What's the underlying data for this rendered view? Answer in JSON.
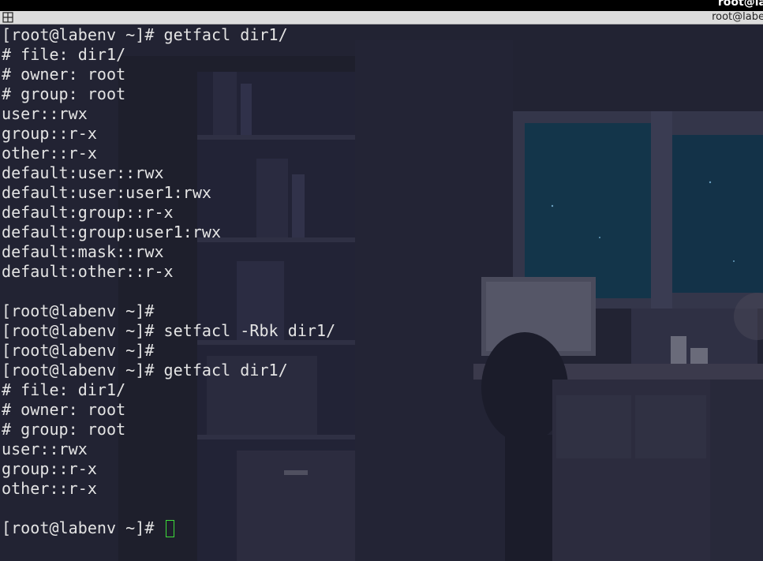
{
  "window": {
    "top_title": "root@la",
    "tab_title": "root@labe"
  },
  "terminal": {
    "lines": [
      "[root@labenv ~]# getfacl dir1/",
      "# file: dir1/",
      "# owner: root",
      "# group: root",
      "user::rwx",
      "group::r-x",
      "other::r-x",
      "default:user::rwx",
      "default:user:user1:rwx",
      "default:group::r-x",
      "default:group:user1:rwx",
      "default:mask::rwx",
      "default:other::r-x",
      "",
      "[root@labenv ~]#",
      "[root@labenv ~]# setfacl -Rbk dir1/",
      "[root@labenv ~]#",
      "[root@labenv ~]# getfacl dir1/",
      "# file: dir1/",
      "# owner: root",
      "# group: root",
      "user::rwx",
      "group::r-x",
      "other::r-x",
      "",
      "[root@labenv ~]# "
    ]
  },
  "icons": {
    "tab": "terminal-grid-icon"
  },
  "colors": {
    "text": "#e4e4e4",
    "cursor": "#3ddc3a",
    "background": "#1c1d2a",
    "tabbar": "#dcdcdc"
  }
}
